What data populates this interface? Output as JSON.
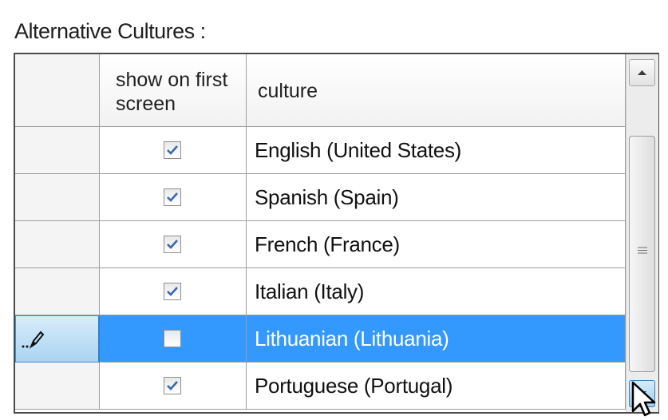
{
  "caption": "Alternative Cultures :",
  "grid": {
    "columns": {
      "show_on_first_screen": "show on first screen",
      "culture": "culture"
    },
    "rows": [
      {
        "checked": true,
        "culture": "English (United States)"
      },
      {
        "checked": true,
        "culture": "Spanish (Spain)"
      },
      {
        "checked": true,
        "culture": "French (France)"
      },
      {
        "checked": true,
        "culture": "Italian (Italy)"
      },
      {
        "checked": false,
        "culture": "Lithuanian (Lithuania)",
        "selected": true,
        "editing": true
      },
      {
        "checked": true,
        "culture": "Portuguese (Portugal)"
      }
    ]
  },
  "colors": {
    "selection": "#3399ff",
    "checkmark": "#3a67b0"
  },
  "icons": {
    "edit_indicator": "pencil-icon",
    "scroll_up": "arrow-up-icon",
    "scroll_down": "arrow-down-icon",
    "cursor": "mouse-pointer-icon"
  }
}
